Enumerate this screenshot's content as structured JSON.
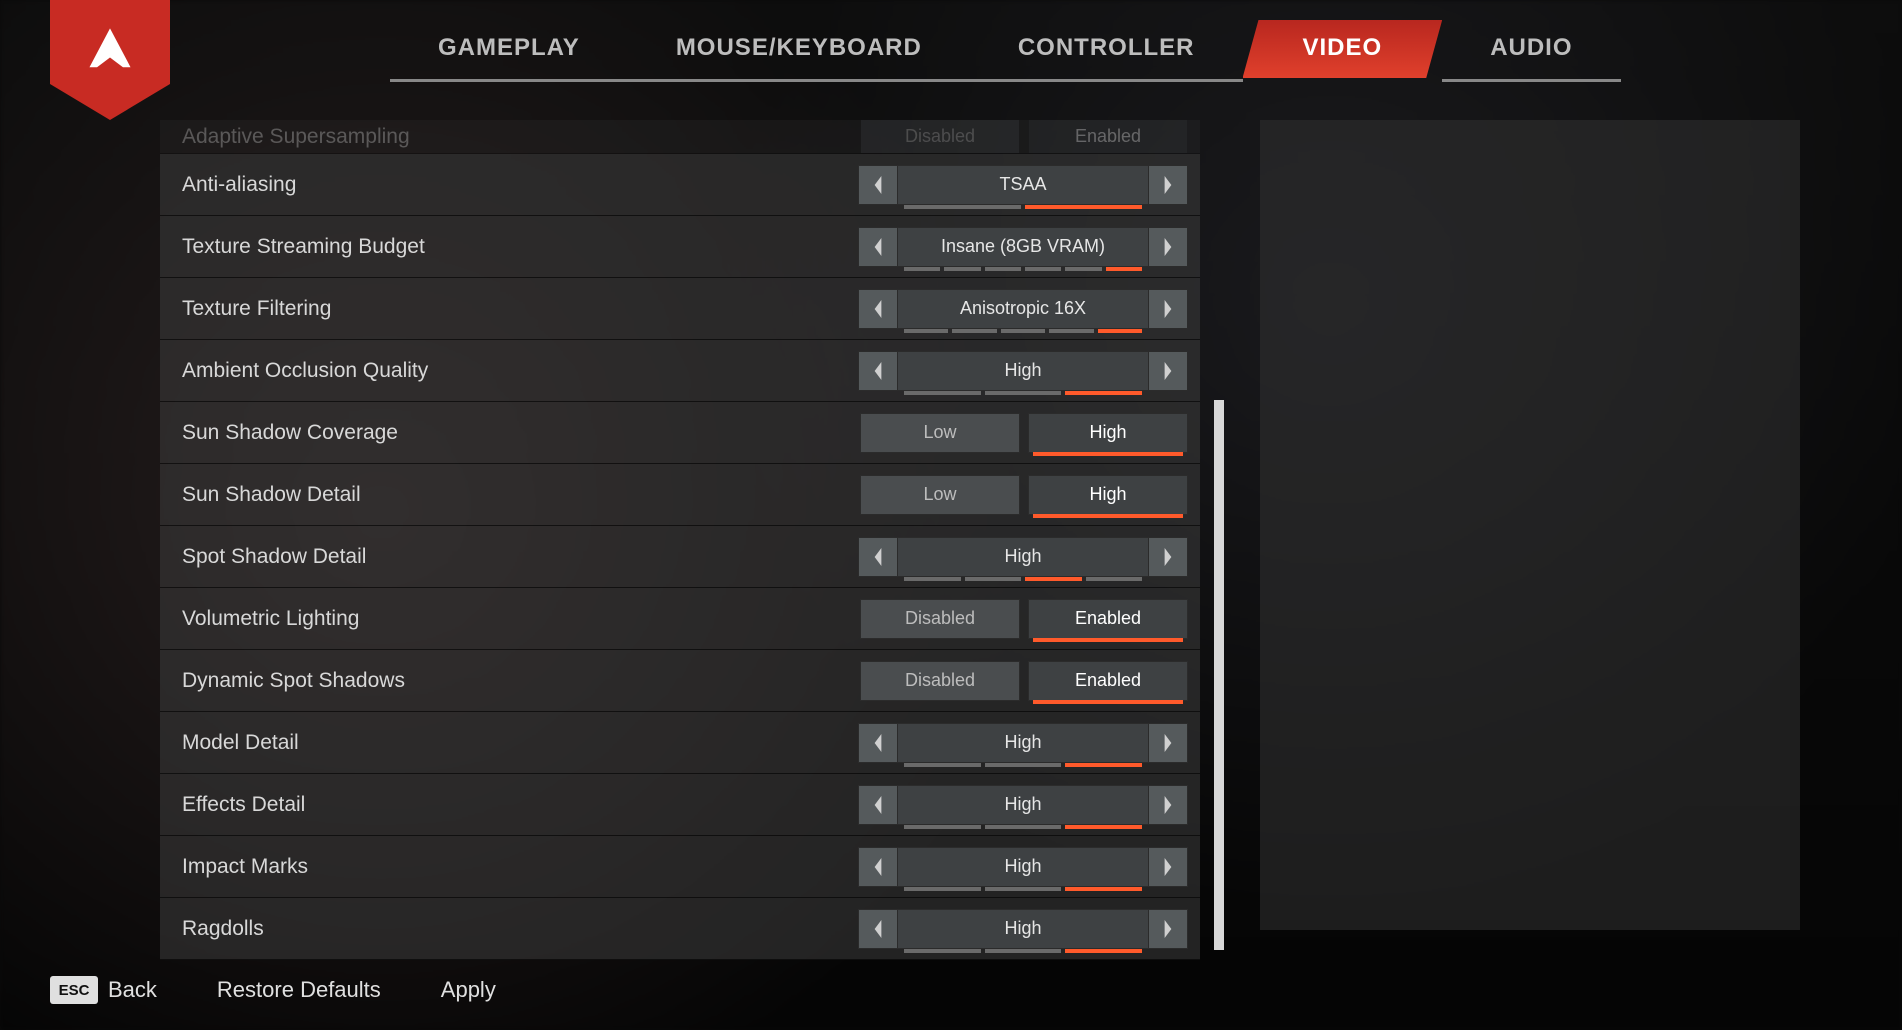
{
  "colors": {
    "accent": "#ff5a2b",
    "brand": "#c82b23"
  },
  "tabs": [
    {
      "label": "GAMEPLAY",
      "active": false
    },
    {
      "label": "MOUSE/KEYBOARD",
      "active": false
    },
    {
      "label": "CONTROLLER",
      "active": false
    },
    {
      "label": "VIDEO",
      "active": true
    },
    {
      "label": "AUDIO",
      "active": false
    }
  ],
  "settings": [
    {
      "type": "toggle-faded",
      "label": "Adaptive Supersampling",
      "options": [
        "Disabled",
        "Enabled"
      ],
      "selected": 1
    },
    {
      "type": "stepper",
      "label": "Anti-aliasing",
      "value": "TSAA",
      "marks": 2,
      "selectedMark": 1
    },
    {
      "type": "stepper",
      "label": "Texture Streaming Budget",
      "value": "Insane (8GB VRAM)",
      "marks": 6,
      "selectedMark": 5
    },
    {
      "type": "stepper",
      "label": "Texture Filtering",
      "value": "Anisotropic 16X",
      "marks": 5,
      "selectedMark": 4
    },
    {
      "type": "stepper",
      "label": "Ambient Occlusion Quality",
      "value": "High",
      "marks": 3,
      "selectedMark": 2
    },
    {
      "type": "toggle",
      "label": "Sun Shadow Coverage",
      "options": [
        "Low",
        "High"
      ],
      "selected": 1
    },
    {
      "type": "toggle",
      "label": "Sun Shadow Detail",
      "options": [
        "Low",
        "High"
      ],
      "selected": 1
    },
    {
      "type": "stepper",
      "label": "Spot Shadow Detail",
      "value": "High",
      "marks": 4,
      "selectedMark": 2
    },
    {
      "type": "toggle",
      "label": "Volumetric Lighting",
      "options": [
        "Disabled",
        "Enabled"
      ],
      "selected": 1
    },
    {
      "type": "toggle",
      "label": "Dynamic Spot Shadows",
      "options": [
        "Disabled",
        "Enabled"
      ],
      "selected": 1
    },
    {
      "type": "stepper",
      "label": "Model Detail",
      "value": "High",
      "marks": 3,
      "selectedMark": 2
    },
    {
      "type": "stepper",
      "label": "Effects Detail",
      "value": "High",
      "marks": 3,
      "selectedMark": 2
    },
    {
      "type": "stepper",
      "label": "Impact Marks",
      "value": "High",
      "marks": 3,
      "selectedMark": 2
    },
    {
      "type": "stepper",
      "label": "Ragdolls",
      "value": "High",
      "marks": 3,
      "selectedMark": 2
    }
  ],
  "footer": {
    "esc_key": "ESC",
    "back": "Back",
    "restore": "Restore Defaults",
    "apply": "Apply"
  }
}
